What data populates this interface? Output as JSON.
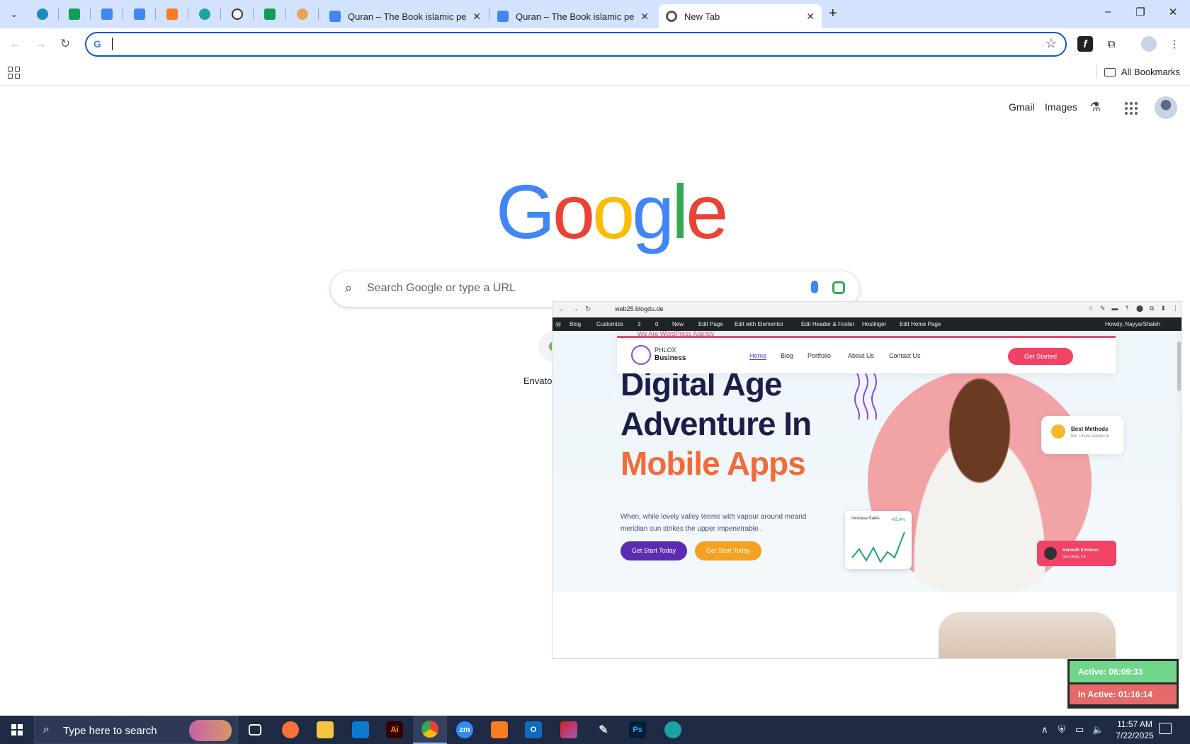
{
  "browser": {
    "tabs": [
      {
        "title": "Quran – The Book islamic peopl",
        "icon": "forms-icon"
      },
      {
        "title": "Quran – The Book islamic peopl",
        "icon": "forms-icon"
      },
      {
        "title": "New Tab",
        "icon": "chrome-icon",
        "active": true
      }
    ],
    "pinned_icons": [
      "wordpress-icon",
      "sheets-icon",
      "docs-icon",
      "docs-icon",
      "xampp-icon",
      "app-icon",
      "openai-icon",
      "sheets-icon",
      "arabic-app-icon"
    ],
    "window_controls": {
      "minimize": "–",
      "restore": "❐",
      "close": "✕"
    },
    "omnibox": {
      "value": "",
      "placeholder": ""
    },
    "bookmarks": {
      "all_label": "All Bookmarks"
    }
  },
  "ntp": {
    "links": {
      "gmail": "Gmail",
      "images": "Images"
    },
    "logo": [
      "G",
      "o",
      "o",
      "g",
      "l",
      "e"
    ],
    "logo_colors": [
      "#4285f4",
      "#ea4335",
      "#fbbc05",
      "#4285f4",
      "#34a853",
      "#ea4335"
    ],
    "search_placeholder": "Search Google or type a URL",
    "shortcut_label": "Envato"
  },
  "embed": {
    "url": "web25.blogdu.de",
    "admin_bar": {
      "blog": "Blog",
      "customize": "Customize",
      "updates": "3",
      "comments": "0",
      "new": "New",
      "edit_page": "Edit Page",
      "elementor": "Edit with Elementor",
      "header_footer": "Edit Header & Footer",
      "hostinger": "Hostinger",
      "edit_home": "Edit Home Page",
      "howdy": "Howdy, NayyarShaikh"
    },
    "site": {
      "tagline": "We Are WordPress Agency",
      "brand_top": "PHLOX",
      "brand_bottom": "Business",
      "menu": [
        "Home",
        "Blog",
        "Portfolio",
        "About Us",
        "Contact Us"
      ],
      "cta": "Get Started",
      "h1_line1": "Digital Age",
      "h1_line2": "Adventure In",
      "h1_line3": "Mobile Apps",
      "paragraph": "When, while lovely valley teems with vapour around meand meridian sun strikes the upper impenetrable .",
      "button1": "Get Start Today",
      "button2": "Get Start Today",
      "badge_title": "Best Methods",
      "badge_sub": "But I must explain to",
      "sales_label": "Increase Sales",
      "sales_value": "+65.4%",
      "user_name": "Kenneth Erickson",
      "user_loc": "San Diego, CA"
    }
  },
  "timer": {
    "active": "Active: 06:09:33",
    "inactive": "In Active: 01:16:14",
    "ghost": "Chrome"
  },
  "taskbar": {
    "search_placeholder": "Type here to search",
    "time": "11:57 AM",
    "date": "7/22/2025"
  }
}
